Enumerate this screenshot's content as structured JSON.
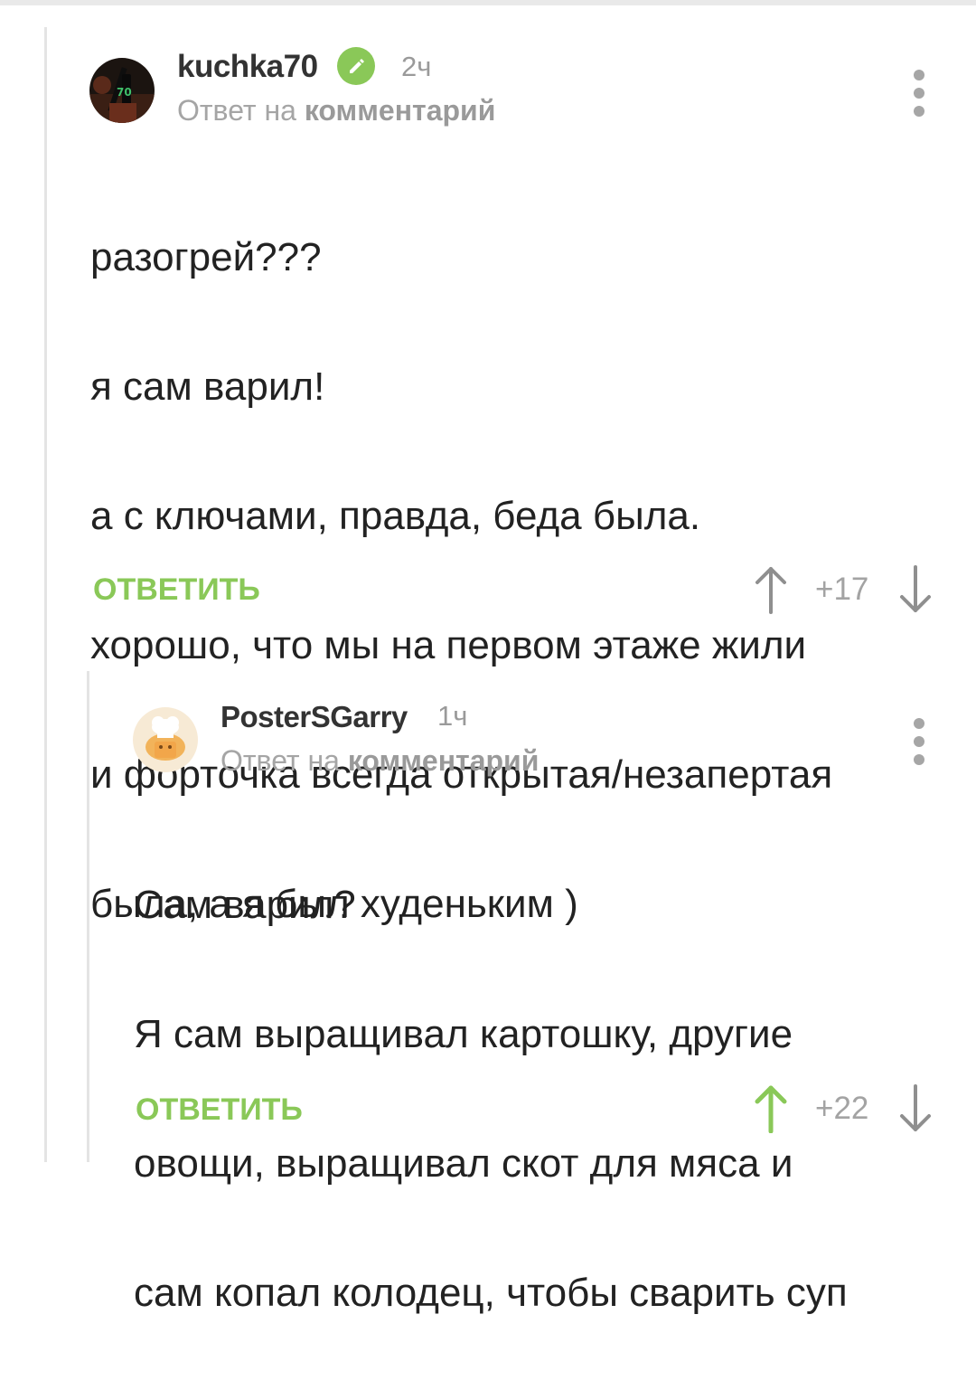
{
  "comments": [
    {
      "username": "kuchka70",
      "verified": true,
      "time": "2ч",
      "reply_prefix": "Ответ на",
      "reply_target": "комментарий",
      "lines": [
        "разогрей???",
        "я сам варил!",
        "а с ключами, правда, беда была.",
        "хорошо, что мы на первом этаже жили",
        "и форточка всегда открытая/незапертая",
        "была, а я был худеньким )"
      ],
      "reply_label": "ОТВЕТИТЬ",
      "score": "+17",
      "upvoted": false
    },
    {
      "username": "PosterSGarry",
      "verified": false,
      "time": "1ч",
      "reply_prefix": "Ответ на",
      "reply_target": "комментарий",
      "lines": [
        "Сам варил?",
        "Я сам выращивал картошку, другие",
        "овощи, выращивал скот для мяса и",
        "сам копал колодец, чтобы сварить суп"
      ],
      "reply_label": "ОТВЕТИТЬ",
      "score": "+22",
      "upvoted": true
    }
  ],
  "colors": {
    "accent_green": "#8ac858",
    "muted_gray": "#a3a3a3",
    "arrow_gray": "#8f8f8f",
    "text": "#222222"
  },
  "icons": [
    "verified-check-icon",
    "more-options-icon",
    "upvote-arrow-icon",
    "downvote-arrow-icon"
  ]
}
